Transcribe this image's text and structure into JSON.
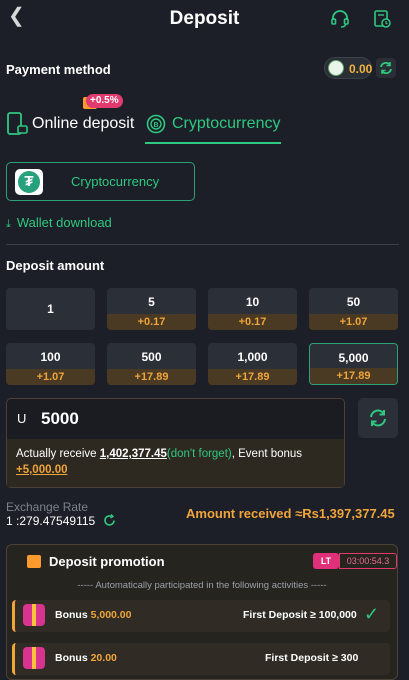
{
  "header": {
    "title": "Deposit",
    "back_icon": "chevron-left-icon",
    "support_icon": "headset-icon",
    "history_icon": "receipt-icon"
  },
  "payment": {
    "label": "Payment method",
    "balance": "0.00",
    "tabs": [
      {
        "label": "Online deposit",
        "badge": "+0.5%"
      },
      {
        "label": "Cryptocurrency"
      }
    ],
    "crypto_option": "Cryptocurrency",
    "wallet_download": "Wallet download"
  },
  "deposit": {
    "label": "Deposit amount",
    "options": [
      {
        "value": "1",
        "bonus": ""
      },
      {
        "value": "5",
        "bonus": "+0.17"
      },
      {
        "value": "10",
        "bonus": "+0.17"
      },
      {
        "value": "50",
        "bonus": "+1.07"
      },
      {
        "value": "100",
        "bonus": "+1.07"
      },
      {
        "value": "500",
        "bonus": "+17.89"
      },
      {
        "value": "1,000",
        "bonus": "+17.89"
      },
      {
        "value": "5,000",
        "bonus": "+17.89"
      }
    ],
    "currency": "U",
    "input_value": "5000",
    "receive_prefix": "Actually receive ",
    "receive_amount": "1,402,377.45",
    "receive_hint": "(don't forget)",
    "event_prefix": ", Event bonus ",
    "event_bonus": "+5,000.00"
  },
  "exchange": {
    "label": "Exchange Rate",
    "value": "1 :279.47549115",
    "amount_received": "Amount received ≈Rs1,397,377.45"
  },
  "promotion": {
    "title": "Deposit promotion",
    "timer_badge": "LT",
    "timer": "03:00:54.3",
    "subtitle": "----- Automatically participated in the following activities -----",
    "rows": [
      {
        "bonus_label": "Bonus ",
        "bonus_value": "5,000.00",
        "condition": "First Deposit ≥ 100,000",
        "done": true
      },
      {
        "bonus_label": "Bonus ",
        "bonus_value": "20.00",
        "condition": "First Deposit ≥ 300",
        "done": false
      }
    ]
  },
  "colors": {
    "accent": "#2ec880",
    "bonus": "#f0a43a",
    "background": "#1c1f27"
  }
}
